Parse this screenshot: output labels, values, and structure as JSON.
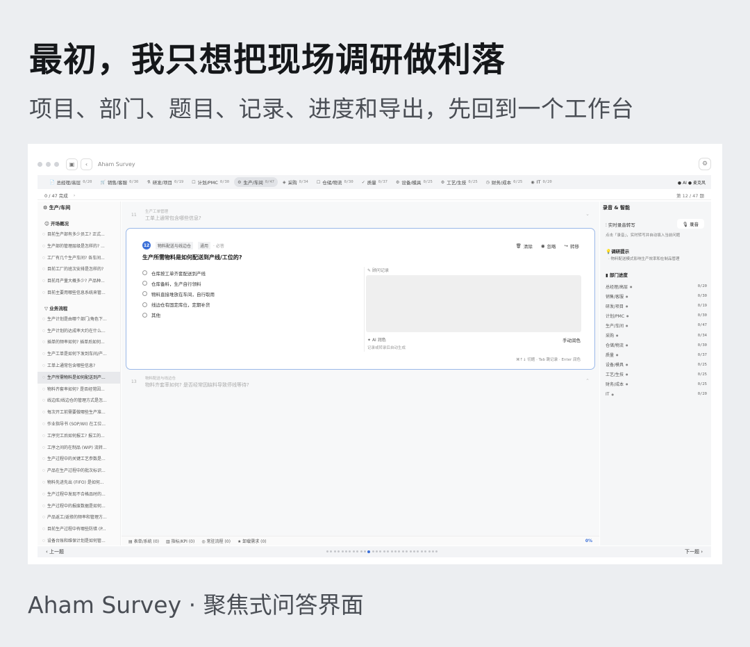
{
  "headline": "最初，我只想把现场调研做利落",
  "subhead": "项目、部门、题目、记录、进度和导出，先回到一个工作台",
  "caption": "Aham Survey · 聚焦式问答界面",
  "window": {
    "title": "Aham Survey",
    "settings_icon": "gear-icon"
  },
  "tabs": [
    {
      "label": "总经理/高层",
      "count": "0/20",
      "icon": "📄"
    },
    {
      "label": "销售/客服",
      "count": "0/30",
      "icon": "🛒"
    },
    {
      "label": "研发/项目",
      "count": "0/19",
      "icon": "⚗"
    },
    {
      "label": "计划/PMC",
      "count": "0/30",
      "icon": "☐"
    },
    {
      "label": "生产/车间",
      "count": "0/47",
      "icon": "⚙"
    },
    {
      "label": "采购",
      "count": "0/34",
      "icon": "◈"
    },
    {
      "label": "仓储/物流",
      "count": "0/30",
      "icon": "☐"
    },
    {
      "label": "质量",
      "count": "0/37",
      "icon": "✓"
    },
    {
      "label": "设备/模具",
      "count": "0/25",
      "icon": "⚙"
    },
    {
      "label": "工艺/生技",
      "count": "0/25",
      "icon": "⚙"
    },
    {
      "label": "财务/成本",
      "count": "0/25",
      "icon": "◷"
    },
    {
      "label": "IT",
      "count": "0/20",
      "icon": "◉"
    }
  ],
  "tabs_right": "● AI ● 麦克风",
  "progress": {
    "left": "0 / 47 完成",
    "right": "第 12 / 47 题"
  },
  "sidebar": {
    "title": "生产/车间",
    "group1": "开场概况",
    "items1": [
      "目前生产部有多少员工? 正式...",
      "生产部的管理层级是怎样的? ...",
      "工厂有几个生产车间? 各车间...",
      "目前工厂的班次安排是怎样的?",
      "目前月产量大概多少? 产品种...",
      "目前主要用哪些信息系统来管..."
    ],
    "group2": "业务流程",
    "items2": [
      "生产计划是由哪个部门/角色下...",
      "生产计划的达成率大约在什么...",
      "插单的频率如何? 插单后如何...",
      "生产工单是如何下发到车间/产...",
      "工单上通常包含哪些信息?",
      "生产所需物料是如何配送到产...",
      "物料齐套率如何? 是否经常因...",
      "线边库/线边仓的管理方式是怎...",
      "每次开工前需要做哪些生产准...",
      "作业指导书 (SOP/WI) 在工位...",
      "工序完工后如何报工? 报工的...",
      "工序之间的在制品 (WIP) 流转...",
      "生产过程中的关键工艺参数是...",
      "产品在生产过程中的批次标识...",
      "物料先进先出 (FIFO) 是如何...",
      "生产过程中发现不合格品时的...",
      "生产过程中的报废数据是如何...",
      "产品返工/返修的频率和管理方...",
      "目前生产过程中有哪些防错 (P...",
      "设备台账和维保计划是如何管..."
    ]
  },
  "question_prev": {
    "num": "11",
    "category": "生产工单管理",
    "text": "工单上通常包含哪些信息?"
  },
  "question": {
    "num": "12",
    "category": "物料配送与线边仓",
    "tag": "通用",
    "required": "· 必答",
    "actions": {
      "clear": "清除",
      "ignore": "忽略",
      "transfer": "转移"
    },
    "title": "生产所需物料是如何配送到产线/工位的?",
    "options": [
      "仓库按工单齐套配送到产线",
      "仓库备料，生产自行领料",
      "物料直接堆放在车间，自行取用",
      "线边仓有固定库位，定期补货",
      "其他"
    ],
    "notes_label": "顾问记录",
    "ai_polish": "AI 润色",
    "manual_polish": "手动润色",
    "notes_hint": "记录或转录后自动生成",
    "shortcuts": "⌘↑↓ 切题 · Tab 跳记录 · Enter 润色"
  },
  "question_next": {
    "num": "13",
    "category": "物料配送与线边仓",
    "text": "物料齐套率如何? 是否经常因缺料导致停线等待?"
  },
  "bottom_bar": {
    "forms": "表单/系统 (0)",
    "kpi": "指标/KPI (0)",
    "abnormal": "常驻流程 (0)",
    "pain": "卸载需求 (0)",
    "percent": "0%"
  },
  "footer": {
    "prev": "上一题",
    "next": "下一题",
    "dot_count": 30,
    "active_dot": 11
  },
  "right_panel": {
    "title": "录音 & 智能",
    "record_label": "实时录音转写",
    "record_button": "录音",
    "record_desc": "点击「录音」，实时转写并自动填入当前问题",
    "tips_title": "调研提示",
    "tips_desc": "· 物料配送模式影响生产效率和在制品管理",
    "dept_title": "部门进度",
    "departments": [
      {
        "name": "总经理/高层",
        "value": "0/20"
      },
      {
        "name": "销售/客服",
        "value": "0/30"
      },
      {
        "name": "研发/项目",
        "value": "0/19"
      },
      {
        "name": "计划/PMC",
        "value": "0/30"
      },
      {
        "name": "生产/车间",
        "value": "0/47"
      },
      {
        "name": "采购",
        "value": "0/34"
      },
      {
        "name": "仓储/物流",
        "value": "0/30"
      },
      {
        "name": "质量",
        "value": "0/37"
      },
      {
        "name": "设备/模具",
        "value": "0/25"
      },
      {
        "name": "工艺/生技",
        "value": "0/25"
      },
      {
        "name": "财务/成本",
        "value": "0/25"
      },
      {
        "name": "IT",
        "value": "0/20"
      }
    ]
  }
}
